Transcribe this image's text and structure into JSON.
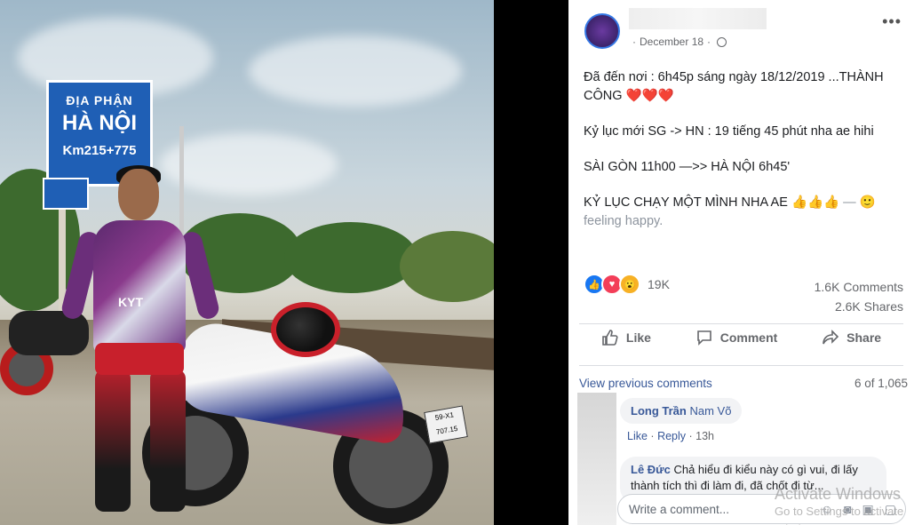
{
  "photo": {
    "sign_line1": "ĐỊA PHẬN",
    "sign_line2": "HÀ NỘI",
    "sign_line3": "Km215+775",
    "jersey_brand": "KYT",
    "plate": "59-X1 707.15"
  },
  "post": {
    "date": "December 18",
    "more_icon": "•••",
    "lines": [
      "Đã đến nơi : 6h45p sáng ngày 18/12/2019 ...THÀNH CÔNG ",
      "Kỷ lục mới SG -> HN : 19 tiếng 45 phút nha ae hihi",
      "SÀI GÒN 11h00 —>> HÀ NỘI 6h45'",
      "KỶ LỤC CHẠY MỘT MÌNH NHA AE "
    ],
    "hearts": "❤️❤️❤️",
    "thumbs": "👍👍👍",
    "feeling_sep": " — ",
    "feeling_emoji": "🙂",
    "feeling": "feeling happy."
  },
  "reactions": {
    "count": "19K",
    "comments": "1.6K Comments",
    "shares": "2.6K Shares"
  },
  "actions": {
    "like": "Like",
    "comment": "Comment",
    "share": "Share"
  },
  "comments": {
    "view_previous": "View previous comments",
    "count": "6 of 1,065",
    "items": [
      {
        "author": "Long Trần",
        "text": "Nam Võ",
        "like": "Like",
        "reply": "Reply",
        "time": "13h"
      },
      {
        "author": "Lê Đức",
        "text": "Chả hiểu đi kiểu này có gì vui, đi lấy thành tích thì đi làm đi, đã chốt đi từ..."
      }
    ],
    "write_placeholder": "Write a comment..."
  },
  "watermark": {
    "line1": "Activate Windows",
    "line2": "Go to Settings to activate Windows."
  },
  "colors": {
    "link": "#385898",
    "like_blue": "#1877f2",
    "love_red": "#f33e58",
    "wow_yellow": "#f7b125"
  }
}
